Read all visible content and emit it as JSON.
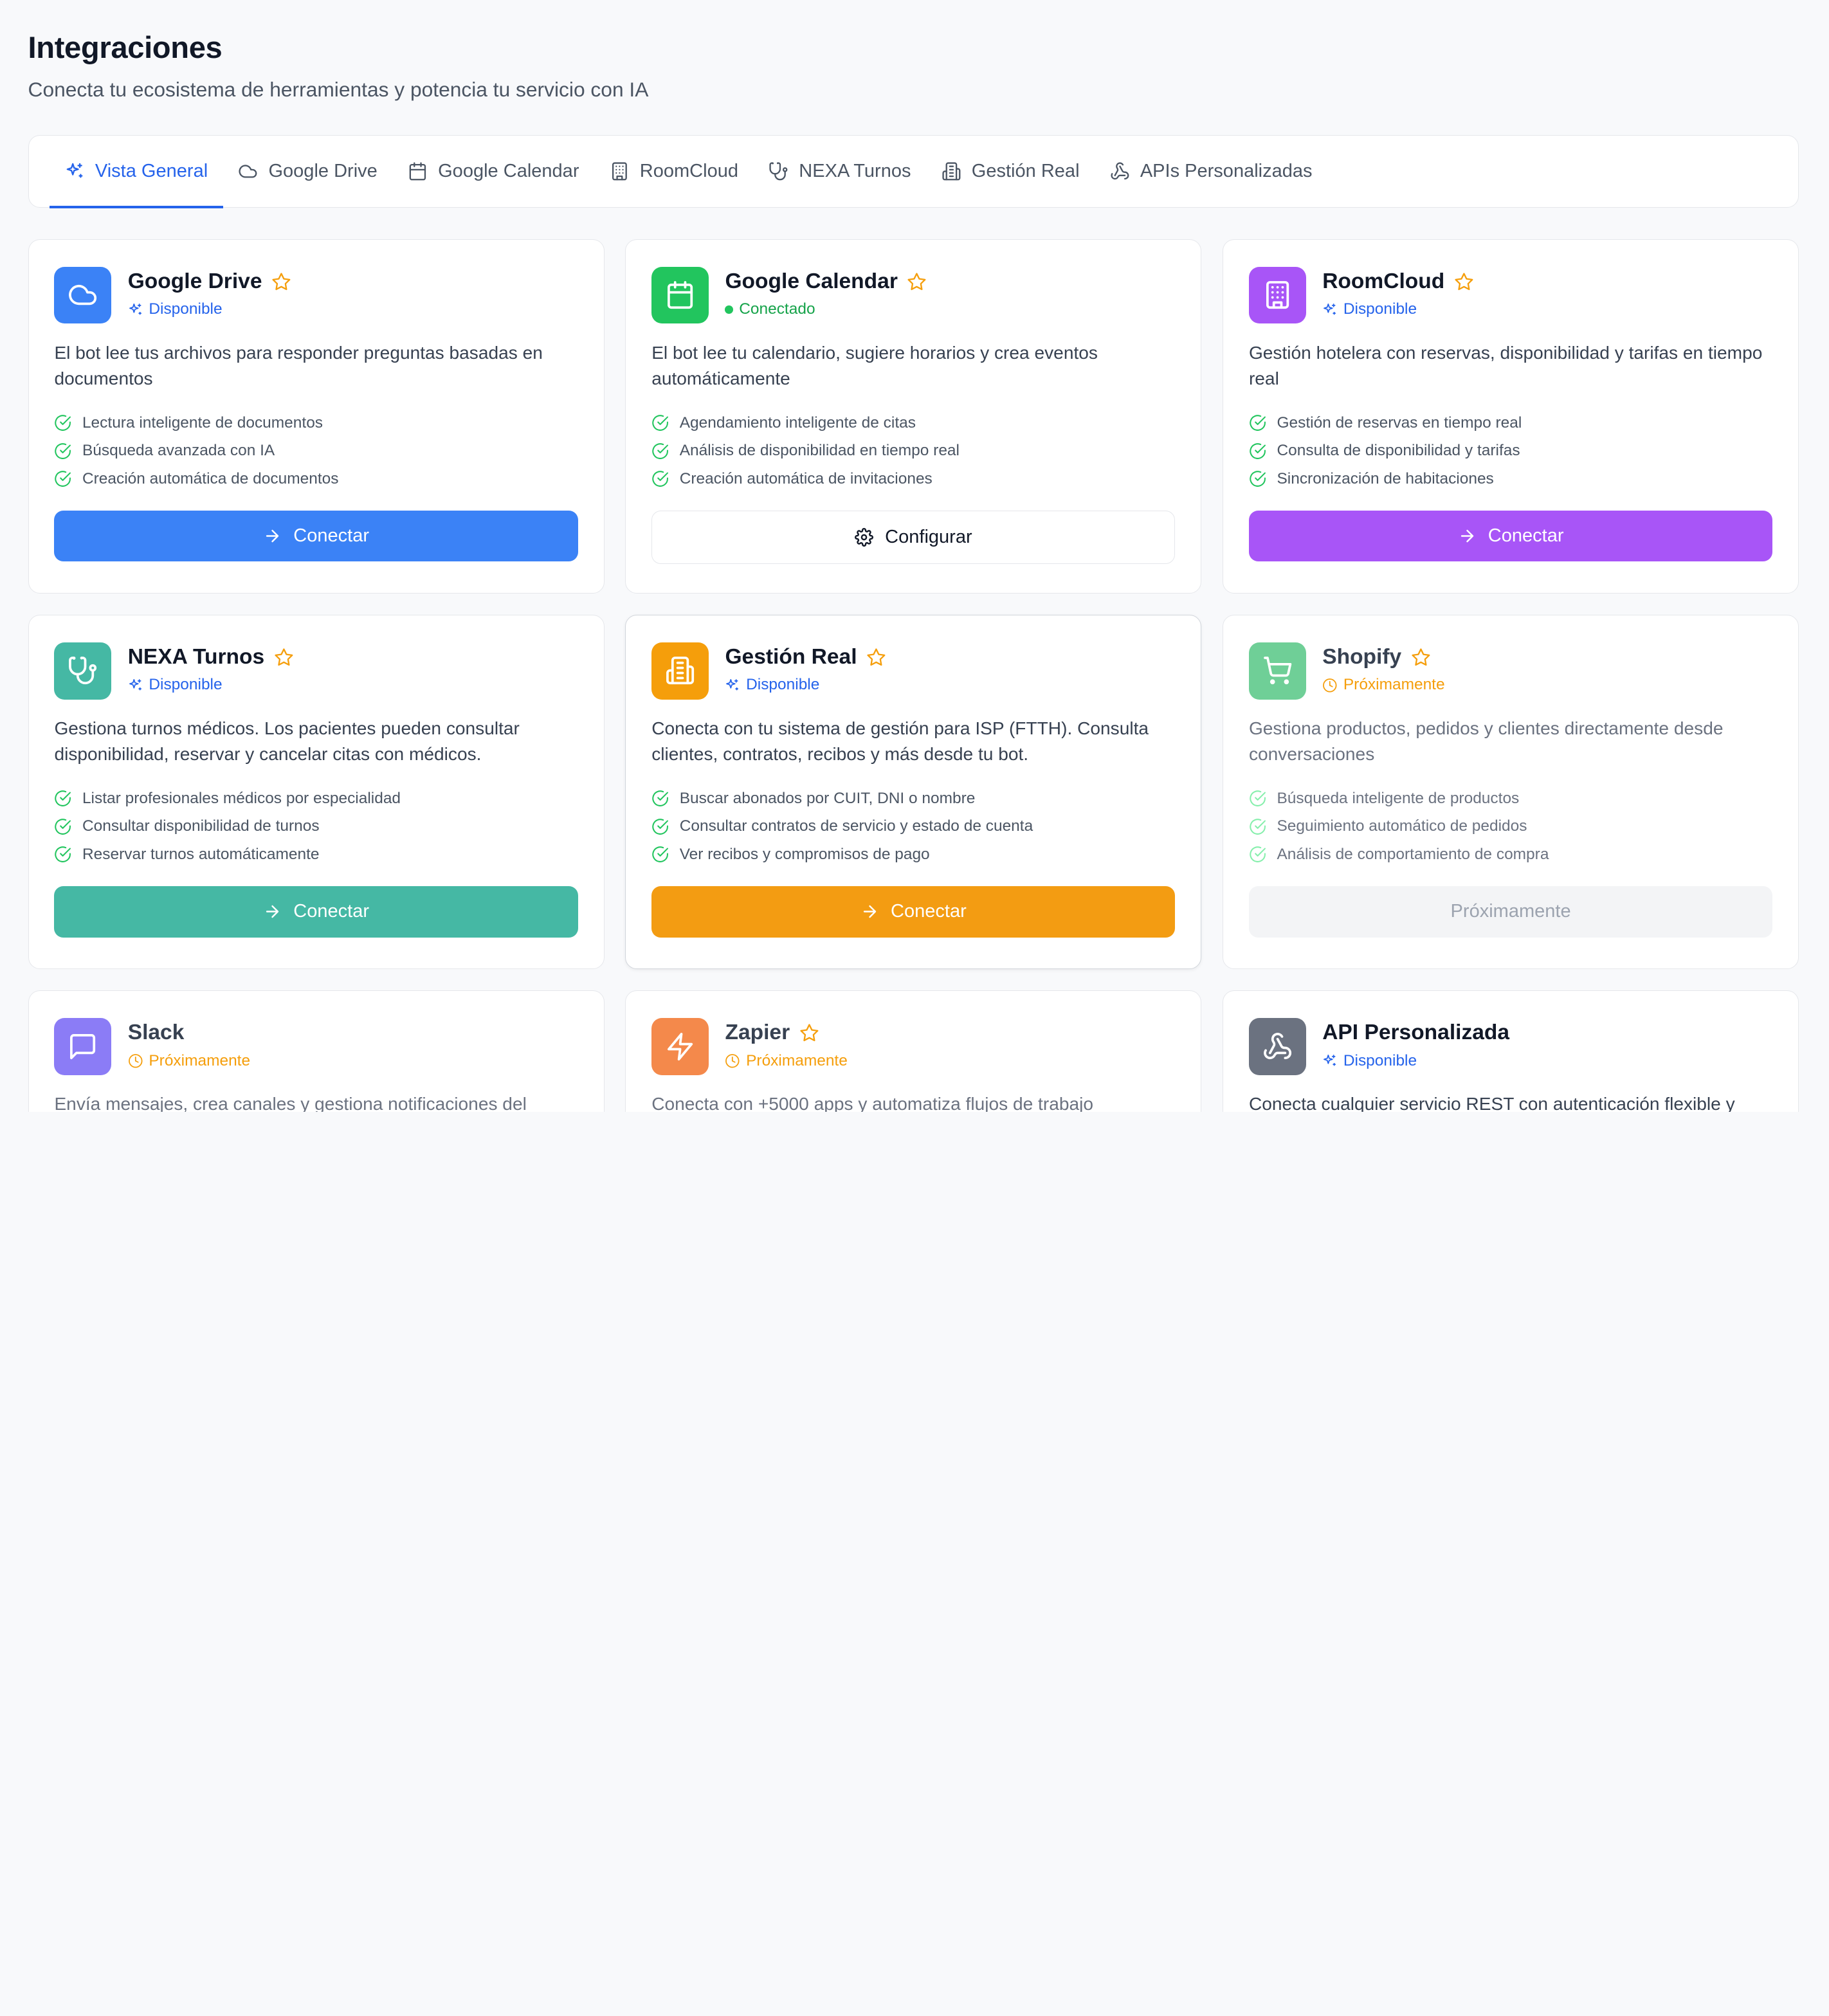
{
  "header": {
    "title": "Integraciones",
    "subtitle": "Conecta tu ecosistema de herramientas y potencia tu servicio con IA"
  },
  "tabs": [
    {
      "label": "Vista General",
      "icon": "sparkles-icon",
      "active": true
    },
    {
      "label": "Google Drive",
      "icon": "cloud-icon"
    },
    {
      "label": "Google Calendar",
      "icon": "calendar-icon"
    },
    {
      "label": "RoomCloud",
      "icon": "building-icon"
    },
    {
      "label": "NEXA Turnos",
      "icon": "stethoscope-icon"
    },
    {
      "label": "Gestión Real",
      "icon": "office-building-icon"
    },
    {
      "label": "APIs Personalizadas",
      "icon": "webhook-icon"
    }
  ],
  "cards": [
    {
      "title": "Google Drive",
      "color": "#3b82f6",
      "icon": "cloud-icon",
      "starred": true,
      "status": "Disponible",
      "status_type": "available",
      "description": "El bot lee tus archivos para responder preguntas basadas en documentos",
      "features": [
        "Lectura inteligente de documentos",
        "Búsqueda avanzada con IA",
        "Creación automática de documentos"
      ],
      "action": {
        "label": "Conectar",
        "style": "filled",
        "color": "#3b82f6"
      }
    },
    {
      "title": "Google Calendar",
      "color": "#22c55e",
      "icon": "calendar-icon",
      "starred": true,
      "status": "Conectado",
      "status_type": "connected",
      "description": "El bot lee tu calendario, sugiere horarios y crea eventos automáticamente",
      "features": [
        "Agendamiento inteligente de citas",
        "Análisis de disponibilidad en tiempo real",
        "Creación automática de invitaciones"
      ],
      "action": {
        "label": "Configurar",
        "style": "outline"
      }
    },
    {
      "title": "RoomCloud",
      "color": "#a855f7",
      "icon": "building-icon",
      "starred": true,
      "status": "Disponible",
      "status_type": "available",
      "description": "Gestión hotelera con reservas, disponibilidad y tarifas en tiempo real",
      "features": [
        "Gestión de reservas en tiempo real",
        "Consulta de disponibilidad y tarifas",
        "Sincronización de habitaciones"
      ],
      "action": {
        "label": "Conectar",
        "style": "filled",
        "color": "#a855f7"
      }
    },
    {
      "title": "NEXA Turnos",
      "color": "#45b8a4",
      "icon": "stethoscope-icon",
      "starred": true,
      "status": "Disponible",
      "status_type": "available",
      "description": "Gestiona turnos médicos. Los pacientes pueden consultar disponibilidad, reservar y cancelar citas con médicos.",
      "features": [
        "Listar profesionales médicos por especialidad",
        "Consultar disponibilidad de turnos",
        "Reservar turnos automáticamente"
      ],
      "action": {
        "label": "Conectar",
        "style": "filled",
        "color": "#45b8a4"
      }
    },
    {
      "title": "Gestión Real",
      "color": "#f59e0b",
      "icon": "office-building-icon",
      "starred": true,
      "highlight": true,
      "status": "Disponible",
      "status_type": "available",
      "description": "Conecta con tu sistema de gestión para ISP (FTTH). Consulta clientes, contratos, recibos y más desde tu bot.",
      "features": [
        "Buscar abonados por CUIT, DNI o nombre",
        "Consultar contratos de servicio y estado de cuenta",
        "Ver recibos y compromisos de pago"
      ],
      "action": {
        "label": "Conectar",
        "style": "filled",
        "color": "#f39c12"
      }
    },
    {
      "title": "Shopify",
      "color": "#6fcf97",
      "icon": "cart-icon",
      "starred": true,
      "dim": true,
      "status": "Próximamente",
      "status_type": "soon",
      "description": "Gestiona productos, pedidos y clientes directamente desde conversaciones",
      "features": [
        "Búsqueda inteligente de productos",
        "Seguimiento automático de pedidos",
        "Análisis de comportamiento de compra"
      ],
      "action": {
        "label": "Próximamente",
        "style": "disabled"
      }
    },
    {
      "title": "Slack",
      "color": "#8b7cf6",
      "icon": "message-square-icon",
      "starred": false,
      "dim": true,
      "status": "Próximamente",
      "status_type": "soon",
      "description": "Envía mensajes, crea canales y gestiona notificaciones del equipo",
      "features": [],
      "action": null
    },
    {
      "title": "Zapier",
      "color": "#f4894b",
      "icon": "zap-icon",
      "starred": true,
      "dim": true,
      "status": "Próximamente",
      "status_type": "soon",
      "description": "Conecta con +5000 apps y automatiza flujos de trabajo",
      "features": [],
      "action": null
    },
    {
      "title": "API Personalizada",
      "color": "#6b7280",
      "icon": "webhook-icon",
      "starred": false,
      "status": "Disponible",
      "status_type": "available",
      "description": "Conecta cualquier servicio REST con autenticación flexible y",
      "features": [],
      "action": null
    }
  ]
}
